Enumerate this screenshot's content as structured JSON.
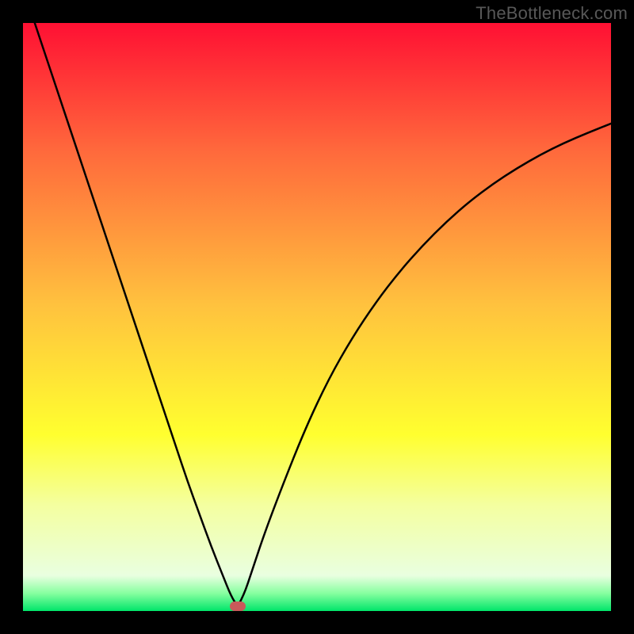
{
  "watermark": "TheBottleneck.com",
  "chart_data": {
    "type": "line",
    "title": "",
    "xlabel": "",
    "ylabel": "",
    "xlim": [
      0,
      100
    ],
    "ylim": [
      0,
      100
    ],
    "grid": false,
    "legend": false,
    "background_gradient_stops": [
      {
        "pct": 0,
        "color": "#ff1033"
      },
      {
        "pct": 22,
        "color": "#ff6a3c"
      },
      {
        "pct": 48,
        "color": "#ffc23e"
      },
      {
        "pct": 70,
        "color": "#ffff2f"
      },
      {
        "pct": 82,
        "color": "#f4ffa0"
      },
      {
        "pct": 94,
        "color": "#e9ffe0"
      },
      {
        "pct": 97,
        "color": "#86ff9f"
      },
      {
        "pct": 100,
        "color": "#00e56a"
      }
    ],
    "series": [
      {
        "name": "bottleneck-left",
        "stroke": "#000000",
        "stroke_width": 2.5,
        "x": [
          2,
          4,
          6,
          8,
          10,
          12,
          14,
          16,
          18,
          20,
          22,
          24,
          26,
          28,
          30,
          32,
          34,
          35.4,
          36.5
        ],
        "y": [
          100,
          94,
          88,
          82,
          76,
          70,
          64,
          58,
          52,
          46,
          40,
          34,
          28,
          22,
          16.5,
          11,
          6,
          2.5,
          0.8
        ]
      },
      {
        "name": "bottleneck-right",
        "stroke": "#000000",
        "stroke_width": 2.5,
        "x": [
          36.5,
          37.5,
          39,
          41,
          44,
          48,
          52,
          56,
          60,
          64,
          68,
          72,
          76,
          80,
          84,
          88,
          92,
          96,
          100
        ],
        "y": [
          0.8,
          2.5,
          7,
          13,
          21,
          31,
          39.5,
          46.5,
          52.5,
          57.7,
          62.2,
          66.2,
          69.7,
          72.7,
          75.3,
          77.6,
          79.6,
          81.3,
          82.9
        ]
      }
    ],
    "markers": [
      {
        "name": "optimum-marker",
        "x": 36.5,
        "y": 0.8,
        "color": "#c95a5a"
      }
    ]
  }
}
